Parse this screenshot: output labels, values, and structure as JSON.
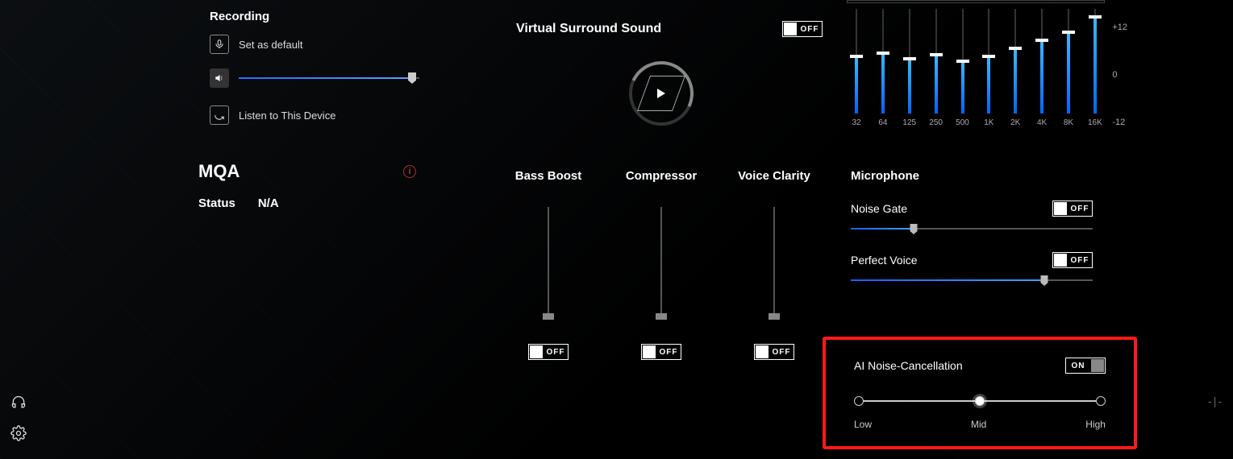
{
  "recording": {
    "title": "Recording",
    "set_default": "Set as default",
    "listen": "Listen to This Device",
    "volume_pct": 96
  },
  "mqa": {
    "title": "MQA",
    "status_label": "Status",
    "status_value": "N/A"
  },
  "vss": {
    "title": "Virtual Surround Sound",
    "state": "OFF"
  },
  "effects": [
    {
      "label": "Bass Boost",
      "state": "OFF",
      "pos": 0
    },
    {
      "label": "Compressor",
      "state": "OFF",
      "pos": 0
    },
    {
      "label": "Voice Clarity",
      "state": "OFF",
      "pos": 0
    }
  ],
  "eq": {
    "scale": {
      "max": "+12",
      "mid": "0",
      "min": "-12"
    },
    "bands": [
      {
        "freq": "32",
        "val": 55
      },
      {
        "freq": "64",
        "val": 58
      },
      {
        "freq": "125",
        "val": 52
      },
      {
        "freq": "250",
        "val": 56
      },
      {
        "freq": "500",
        "val": 50
      },
      {
        "freq": "1K",
        "val": 55
      },
      {
        "freq": "2K",
        "val": 62
      },
      {
        "freq": "4K",
        "val": 70
      },
      {
        "freq": "8K",
        "val": 78
      },
      {
        "freq": "16K",
        "val": 92
      }
    ]
  },
  "mic": {
    "title": "Microphone",
    "noise_gate": {
      "label": "Noise Gate",
      "state": "OFF",
      "pos": 26
    },
    "perfect_voice": {
      "label": "Perfect Voice",
      "state": "OFF",
      "pos": 80
    }
  },
  "ai": {
    "label": "AI Noise-Cancellation",
    "state": "ON",
    "levels": [
      "Low",
      "Mid",
      "High"
    ],
    "active_index": 1
  }
}
